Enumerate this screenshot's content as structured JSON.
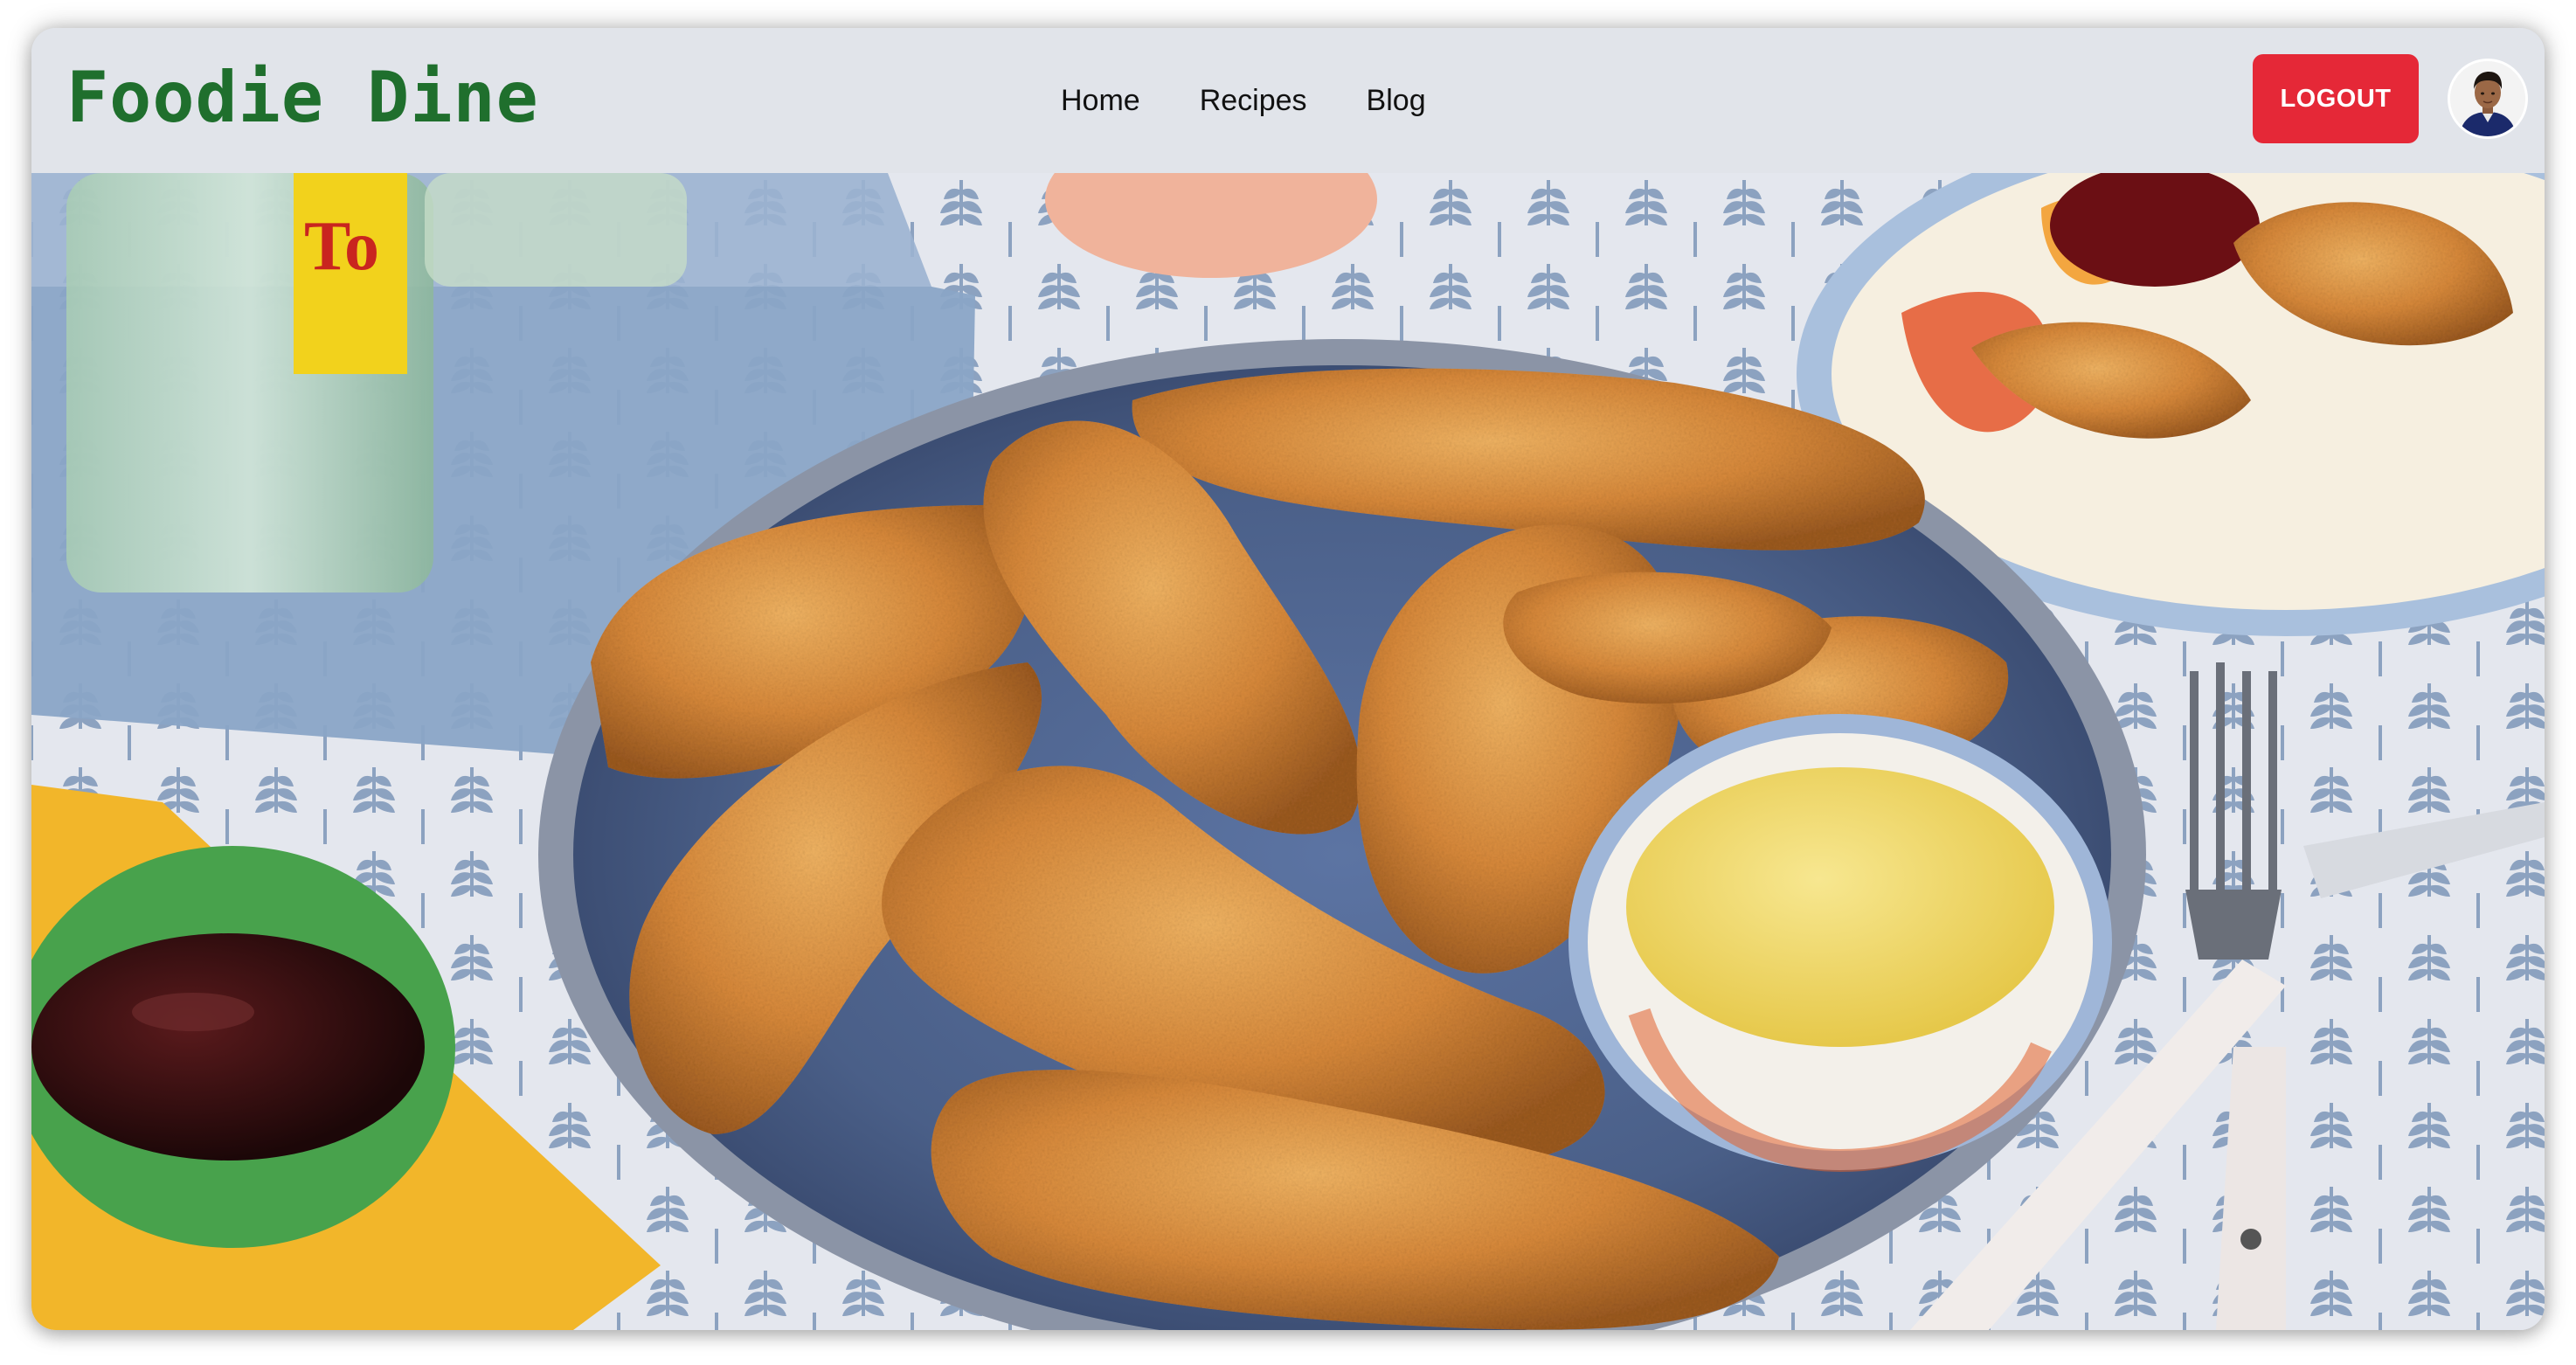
{
  "app": {
    "brand_name": "Foodie Dine"
  },
  "nav": {
    "links": [
      {
        "label": "Home"
      },
      {
        "label": "Recipes"
      },
      {
        "label": "Blog"
      }
    ]
  },
  "user": {
    "logout_label": "LOGOUT",
    "avatar_icon": "user-avatar-photo"
  },
  "hero": {
    "image_subject": "crispy chicken tenders on a blue plate with honey mustard and barbecue sauce dips"
  },
  "colors": {
    "brand": "#1f6f2d",
    "logout_button": "#e52837",
    "navbar_background": "#e1e4ea"
  }
}
